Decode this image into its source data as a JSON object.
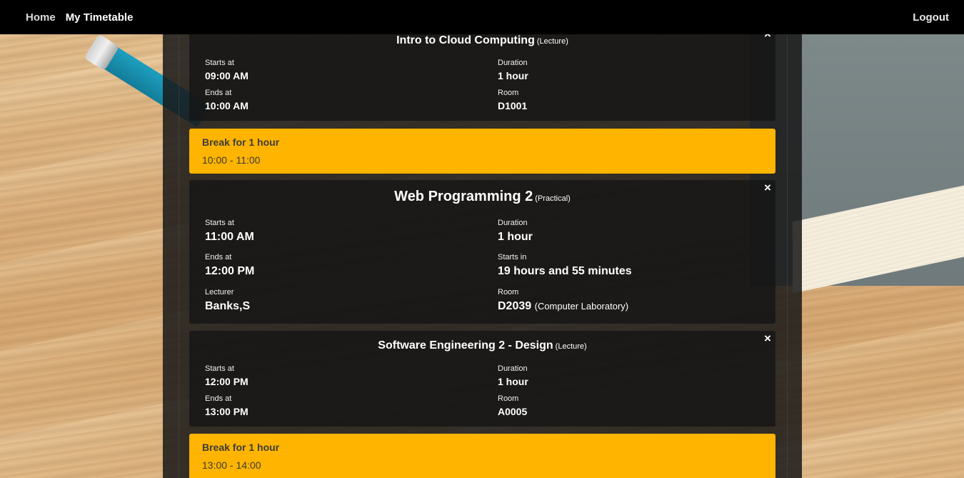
{
  "nav": {
    "home": "Home",
    "timetable": "My Timetable",
    "logout": "Logout"
  },
  "cards": [
    {
      "title": "Intro to Cloud Computing",
      "type": "(Lecture)",
      "starts_label": "Starts at",
      "starts": "09:00 AM",
      "ends_label": "Ends at",
      "ends": "10:00 AM",
      "duration_label": "Duration",
      "duration": "1 hour",
      "room_label": "Room",
      "room": "D1001"
    },
    {
      "title": "Web Programming 2",
      "type": "(Practical)",
      "starts_label": "Starts at",
      "starts": "11:00 AM",
      "ends_label": "Ends at",
      "ends": "12:00 PM",
      "duration_label": "Duration",
      "duration": "1 hour",
      "startsin_label": "Starts in",
      "startsin": "19 hours and 55 minutes",
      "lecturer_label": "Lecturer",
      "lecturer": "Banks,S",
      "room_label": "Room",
      "room": "D2039",
      "room_note": "(Computer Laboratory)"
    },
    {
      "title": "Software Engineering 2 - Design",
      "type": "(Lecture)",
      "starts_label": "Starts at",
      "starts": "12:00 PM",
      "ends_label": "Ends at",
      "ends": "13:00 PM",
      "duration_label": "Duration",
      "duration": "1 hour",
      "room_label": "Room",
      "room": "A0005"
    }
  ],
  "breaks": [
    {
      "title": "Break for 1 hour",
      "range": "10:00 - 11:00"
    },
    {
      "title": "Break for 1 hour",
      "range": "13:00 - 14:00"
    }
  ],
  "close_glyph": "×",
  "colors": {
    "break": "#ffb400",
    "nav": "#000000"
  }
}
